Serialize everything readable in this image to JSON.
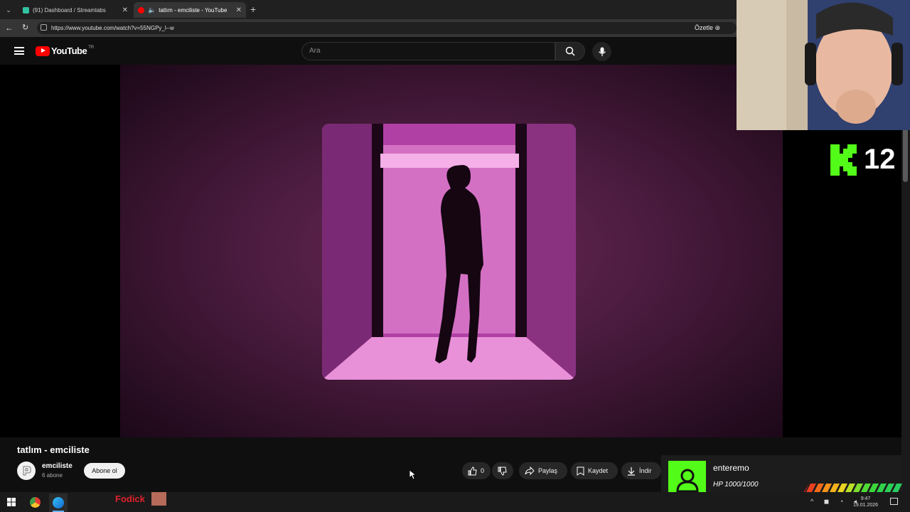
{
  "browser": {
    "tabs": [
      {
        "label": "(91) Dashboard / Streamlabs",
        "active": false
      },
      {
        "label": "tatlım - emciliste - YouTube",
        "active": true
      }
    ],
    "url": "https://www.youtube.com/watch?v=55NGPy_l--w",
    "summarize_label": "Özetle"
  },
  "youtube": {
    "logo_text": "YouTube",
    "region": "TR",
    "search_placeholder": "Ara"
  },
  "overlay": {
    "kick_count": "12",
    "alert_name": "enteremo",
    "alert_hp": "HP 1000/1000",
    "taskbar_label": "Fodick"
  },
  "video": {
    "title": "tatlım - emciliste",
    "channel": "emciliste",
    "subscribers": "6 abone",
    "subscribe_label": "Abone ol",
    "likes": "0",
    "share_label": "Paylaş",
    "save_label": "Kaydet",
    "download_label": "İndir"
  },
  "taskbar": {
    "time": "9:47",
    "date": "19.01.2026"
  },
  "colors": {
    "kick_green": "#53fc18",
    "alert_red": "#e0202a"
  }
}
